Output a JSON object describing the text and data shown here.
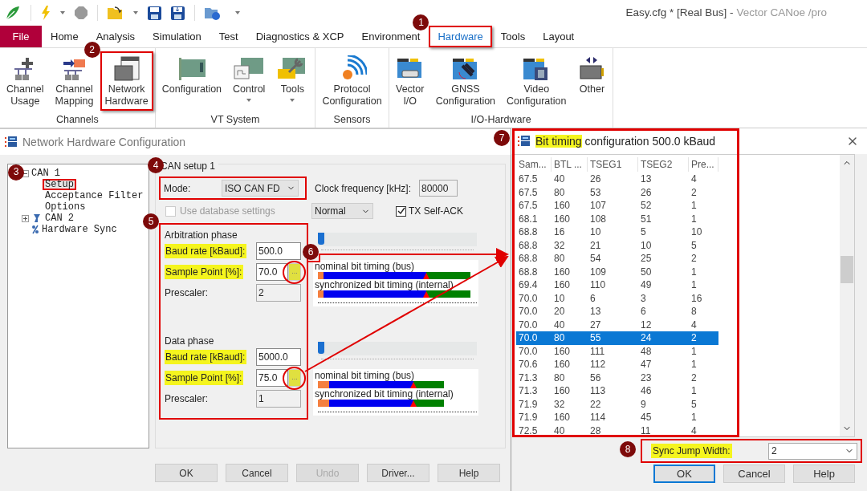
{
  "app_title": {
    "document": "Easy.cfg * [Real Bus] -",
    "product": "Vector CANoe /pro"
  },
  "menu_tabs": [
    {
      "label": "File",
      "kind": "file",
      "selected": false,
      "framed": false
    },
    {
      "label": "Home",
      "kind": "tab",
      "selected": false,
      "framed": false
    },
    {
      "label": "Analysis",
      "kind": "tab",
      "selected": false,
      "framed": false
    },
    {
      "label": "Simulation",
      "kind": "tab",
      "selected": false,
      "framed": false
    },
    {
      "label": "Test",
      "kind": "tab",
      "selected": false,
      "framed": false
    },
    {
      "label": "Diagnostics & XCP",
      "kind": "tab",
      "selected": false,
      "framed": false
    },
    {
      "label": "Environment",
      "kind": "tab",
      "selected": false,
      "framed": false
    },
    {
      "label": "Hardware",
      "kind": "tab",
      "selected": true,
      "framed": true,
      "marker": "1"
    },
    {
      "label": "Tools",
      "kind": "tab",
      "selected": false,
      "framed": false
    },
    {
      "label": "Layout",
      "kind": "tab",
      "selected": false,
      "framed": false
    }
  ],
  "ribbon_groups": [
    {
      "label": "Channels",
      "buttons": [
        {
          "label": "Channel Usage",
          "dropdown": false,
          "framed": false
        },
        {
          "label": "Channel Mapping",
          "dropdown": false,
          "framed": false
        },
        {
          "label": "Network Hardware",
          "dropdown": false,
          "framed": true,
          "marker": "2"
        }
      ]
    },
    {
      "label": "VT System",
      "buttons": [
        {
          "label": "Configuration",
          "dropdown": false,
          "framed": false
        },
        {
          "label": "Control",
          "dropdown": true,
          "framed": false
        },
        {
          "label": "Tools",
          "dropdown": true,
          "framed": false
        }
      ]
    },
    {
      "label": "Sensors",
      "buttons": [
        {
          "label": "Protocol Configuration",
          "dropdown": false,
          "framed": false
        }
      ]
    },
    {
      "label": "I/O-Hardware",
      "buttons": [
        {
          "label": "Vector I/O",
          "dropdown": false,
          "framed": false
        },
        {
          "label": "GNSS Configuration",
          "dropdown": false,
          "framed": false
        },
        {
          "label": "Video Configuration",
          "dropdown": false,
          "framed": false
        },
        {
          "label": "Other",
          "dropdown": false,
          "framed": false
        }
      ]
    }
  ],
  "hw_dialog": {
    "title": "Network Hardware Configuration",
    "tree": [
      {
        "label": "CAN 1",
        "expanded": true,
        "marker": "3",
        "children": [
          {
            "label": "Setup",
            "selected": true,
            "framed": true
          },
          {
            "label": "Acceptance Filter",
            "selected": false,
            "framed": false
          },
          {
            "label": "Options",
            "selected": false,
            "framed": false
          }
        ]
      },
      {
        "label": "CAN 2",
        "expanded": false
      },
      {
        "label": "Hardware Sync"
      }
    ],
    "setup": {
      "title": "CAN setup 1",
      "marker": "4",
      "mode": {
        "label": "Mode:",
        "value": "ISO CAN FD",
        "framed": true
      },
      "clock": {
        "label": "Clock frequency [kHz]:",
        "value": "80000"
      },
      "use_database": {
        "label": "Use database settings",
        "checked": false,
        "disabled": true
      },
      "output_mode": {
        "value": "Normal"
      },
      "tx_self_ack": {
        "label": "TX Self-ACK",
        "checked": true
      }
    },
    "phases_frame": {
      "framed": true,
      "marker": "5"
    },
    "phases": [
      {
        "title": "Arbitration phase",
        "kind": "arbitration",
        "fields": [
          {
            "label": "Baud rate [kBaud]:",
            "value": "500.0",
            "highlighted": true,
            "readonly": false
          },
          {
            "label": "Sample Point [%]:",
            "value": "70.0",
            "highlighted": true,
            "readonly": false,
            "button": {
              "label": "...",
              "highlighted": true,
              "circled": true,
              "marker": "6"
            }
          },
          {
            "label": "Prescaler:",
            "value": "2",
            "highlighted": false,
            "readonly": true
          }
        ],
        "slider": {
          "level": 0
        },
        "nominal": "nominal bit timing (bus)",
        "synchronized": "synchronized bit timing (internal)"
      },
      {
        "title": "Data phase",
        "kind": "data",
        "fields": [
          {
            "label": "Baud rate [kBaud]:",
            "value": "5000.0",
            "highlighted": true,
            "readonly": false
          },
          {
            "label": "Sample Point [%]:",
            "value": "75.0",
            "highlighted": true,
            "readonly": false,
            "button": {
              "label": "...",
              "highlighted": true,
              "circled": true
            }
          },
          {
            "label": "Prescaler:",
            "value": "1",
            "highlighted": false,
            "readonly": true
          }
        ],
        "slider": {
          "level": 0
        },
        "nominal": "nominal bit timing (bus)",
        "synchronized": "synchronized bit timing (internal)"
      }
    ],
    "buttons": [
      {
        "label": "OK",
        "disabled": false
      },
      {
        "label": "Cancel",
        "disabled": false
      },
      {
        "label": "Undo",
        "disabled": true
      },
      {
        "label": "Driver...",
        "disabled": false
      },
      {
        "label": "Help",
        "disabled": false
      }
    ]
  },
  "bt_dialog": {
    "title": {
      "highlight": "Bit timing",
      "rest": "configuration 500.0 kBaud"
    },
    "marker": "7",
    "framed": true,
    "table": {
      "columns": [
        "Sam...",
        "BTL ...",
        "TSEG1",
        "TSEG2",
        "Pre..."
      ],
      "rows": [
        {
          "cells": [
            "67.5",
            "40",
            "26",
            "13",
            "4"
          ],
          "selected": false
        },
        {
          "cells": [
            "67.5",
            "80",
            "53",
            "26",
            "2"
          ],
          "selected": false
        },
        {
          "cells": [
            "67.5",
            "160",
            "107",
            "52",
            "1"
          ],
          "selected": false
        },
        {
          "cells": [
            "68.1",
            "160",
            "108",
            "51",
            "1"
          ],
          "selected": false
        },
        {
          "cells": [
            "68.8",
            "16",
            "10",
            "5",
            "10"
          ],
          "selected": false
        },
        {
          "cells": [
            "68.8",
            "32",
            "21",
            "10",
            "5"
          ],
          "selected": false
        },
        {
          "cells": [
            "68.8",
            "80",
            "54",
            "25",
            "2"
          ],
          "selected": false
        },
        {
          "cells": [
            "68.8",
            "160",
            "109",
            "50",
            "1"
          ],
          "selected": false
        },
        {
          "cells": [
            "69.4",
            "160",
            "110",
            "49",
            "1"
          ],
          "selected": false
        },
        {
          "cells": [
            "70.0",
            "10",
            "6",
            "3",
            "16"
          ],
          "selected": false
        },
        {
          "cells": [
            "70.0",
            "20",
            "13",
            "6",
            "8"
          ],
          "selected": false
        },
        {
          "cells": [
            "70.0",
            "40",
            "27",
            "12",
            "4"
          ],
          "selected": false
        },
        {
          "cells": [
            "70.0",
            "80",
            "55",
            "24",
            "2"
          ],
          "selected": true
        },
        {
          "cells": [
            "70.0",
            "160",
            "111",
            "48",
            "1"
          ],
          "selected": false
        },
        {
          "cells": [
            "70.6",
            "160",
            "112",
            "47",
            "1"
          ],
          "selected": false
        },
        {
          "cells": [
            "71.3",
            "80",
            "56",
            "23",
            "2"
          ],
          "selected": false
        },
        {
          "cells": [
            "71.3",
            "160",
            "113",
            "46",
            "1"
          ],
          "selected": false
        },
        {
          "cells": [
            "71.9",
            "32",
            "22",
            "9",
            "5"
          ],
          "selected": false
        },
        {
          "cells": [
            "71.9",
            "160",
            "114",
            "45",
            "1"
          ],
          "selected": false
        },
        {
          "cells": [
            "72.5",
            "40",
            "28",
            "11",
            "4"
          ],
          "selected": false
        }
      ]
    },
    "sync_jump": {
      "label": "Sync Jump Width:",
      "value": "2",
      "highlighted": true,
      "framed": true,
      "marker": "8"
    },
    "buttons": [
      {
        "label": "OK",
        "default": true
      },
      {
        "label": "Cancel",
        "default": false
      },
      {
        "label": "Help",
        "default": false
      }
    ]
  }
}
